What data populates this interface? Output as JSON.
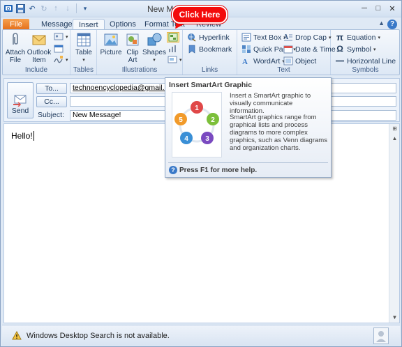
{
  "window": {
    "title": "New Message - Message (HTML)",
    "title_visible": "New Me                                    (HTML)"
  },
  "tabs": [
    {
      "label": "File"
    },
    {
      "label": "Message"
    },
    {
      "label": "Insert"
    },
    {
      "label": "Options"
    },
    {
      "label": "Format Text"
    },
    {
      "label": "Review"
    }
  ],
  "ribbon": {
    "include": {
      "label": "Include",
      "attach_file": "Attach\nFile",
      "outlook_item": "Outlook\nItem"
    },
    "tables": {
      "label": "Tables",
      "table": "Table"
    },
    "illustrations": {
      "label": "Illustrations",
      "picture": "Picture",
      "clip_art": "Clip\nArt",
      "shapes": "Shapes"
    },
    "links": {
      "label": "Links",
      "hyperlink": "Hyperlink",
      "bookmark": "Bookmark"
    },
    "text": {
      "label": "Text",
      "text_box": "Text Box",
      "quick_parts": "Quick Parts",
      "wordart": "WordArt",
      "drop_cap": "Drop Cap",
      "date_time": "Date & Time",
      "object": "Object"
    },
    "symbols": {
      "label": "Symbols",
      "equation": "Equation",
      "symbol": "Symbol",
      "horizontal_line": "Horizontal Line"
    }
  },
  "compose": {
    "send": "Send",
    "to_button": "To...",
    "cc_button": "Cc...",
    "to_value": "technoencyclopedia@gmail.com",
    "cc_value": "",
    "subject_label": "Subject:",
    "subject_value": "New Message!"
  },
  "body": {
    "text": "Hello!"
  },
  "tooltip": {
    "title": "Insert SmartArt Graphic",
    "desc1": "Insert a SmartArt graphic to visually communicate information.",
    "desc2": "SmartArt graphics range from graphical lists and process diagrams to more complex graphics, such as Venn diagrams and organization charts.",
    "help": "Press F1 for more help.",
    "numbers": [
      "1",
      "2",
      "3",
      "4",
      "5"
    ]
  },
  "callout": {
    "text": "Click Here"
  },
  "status": {
    "text": "Windows Desktop Search is not available."
  },
  "colors": {
    "file_tab": "#e36b16",
    "callout": "#f30b0b",
    "ribbon_bg": "#dde8f5"
  }
}
